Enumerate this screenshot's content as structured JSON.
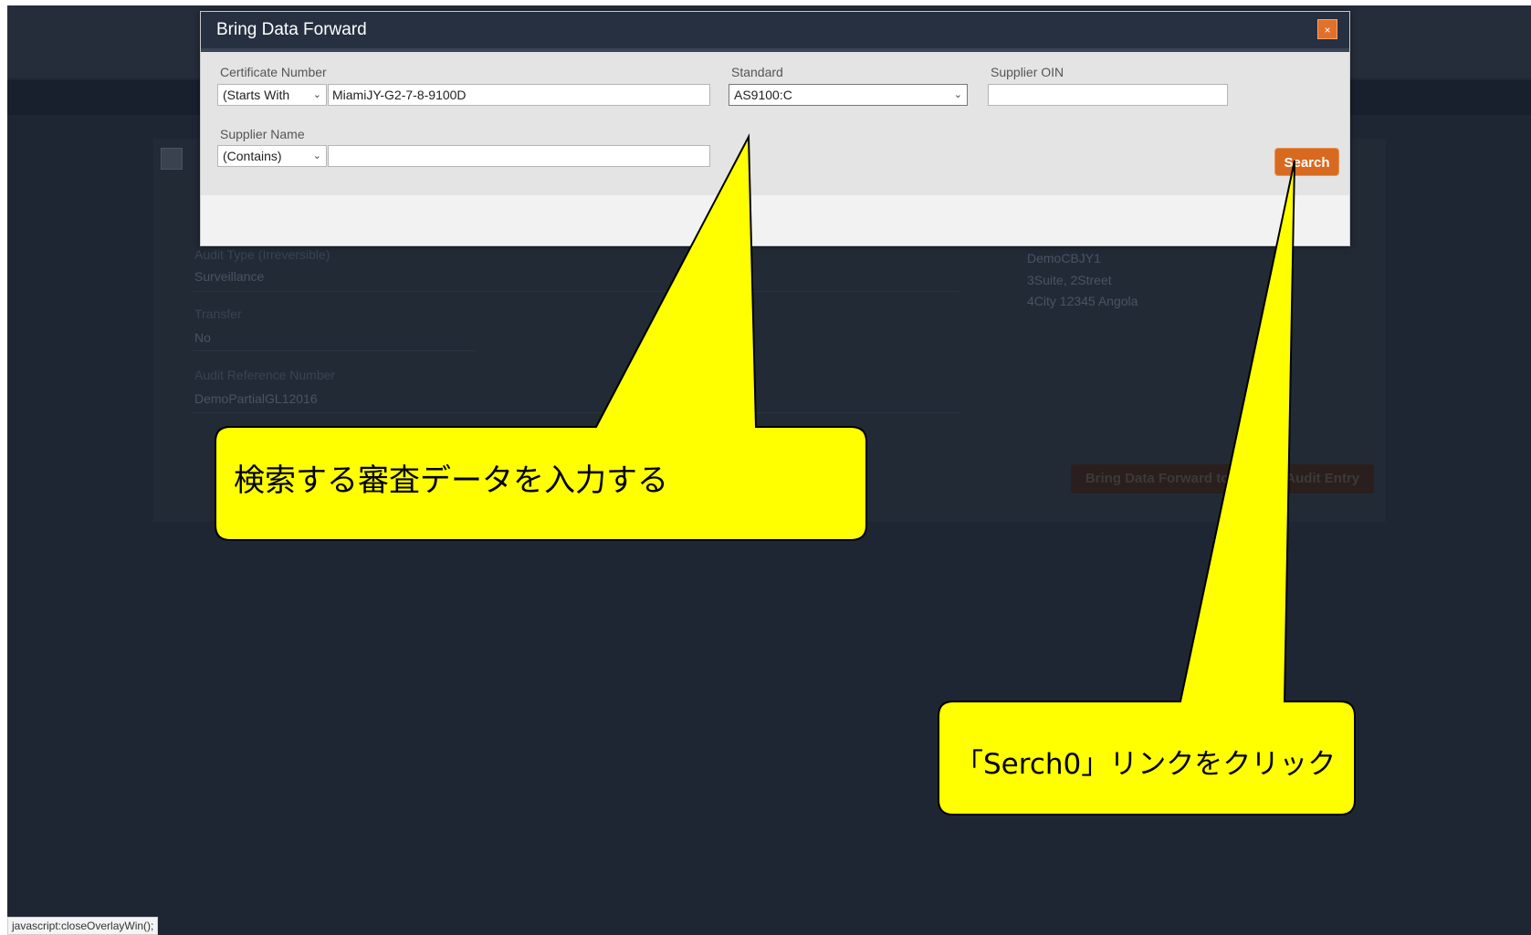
{
  "background": {
    "audit_type_label": "Audit Type (Irreversible)",
    "audit_type_value": "Surveillance",
    "transfer_label": "Transfer",
    "transfer_value": "No",
    "audit_ref_label": "Audit Reference Number",
    "audit_ref_value": "DemoPartialGL12016",
    "supplier_name": "DemoCBJY1",
    "supplier_address1": "3Suite, 2Street",
    "supplier_address2": "4City 12345 Angola",
    "bring_forward_button": "Bring Data Forward to Current Audit Entry"
  },
  "modal": {
    "title": "Bring Data Forward",
    "close_label": "×",
    "certificate_number": {
      "label": "Certificate Number",
      "operator": "(Starts With",
      "value": "MiamiJY-G2-7-8-9100D"
    },
    "standard": {
      "label": "Standard",
      "value": "AS9100:C"
    },
    "supplier_oin": {
      "label": "Supplier OIN",
      "value": ""
    },
    "supplier_name": {
      "label": "Supplier Name",
      "operator": "(Contains)",
      "value": ""
    },
    "search_label": "Search"
  },
  "callouts": {
    "input_hint": "検索する審査データを入力する",
    "search_hint": "「Serch0」リンクをクリック"
  },
  "statusbar": {
    "text": "javascript:closeOverlayWin();"
  },
  "icons": {
    "chevron": "chevron-down-icon",
    "close": "close-icon"
  },
  "colors": {
    "accent": "#d86a1f",
    "callout": "#ffff00",
    "header": "#263040"
  }
}
